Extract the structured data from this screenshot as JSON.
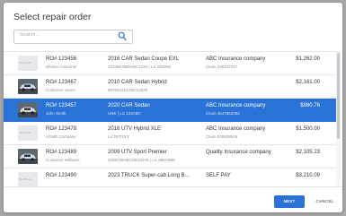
{
  "dialog": {
    "title": "Select repair order"
  },
  "search": {
    "placeholder": "Search..."
  },
  "rows": [
    {
      "ro": "RO# 123456",
      "customer": "Sholon Customer",
      "vehicle": "2016 CAR Sedan Coupe EXL",
      "vin": "1234567890ABC1234  |  Lic 000000",
      "insurer": "ABC Insurance company",
      "claim": "Claim 346247247",
      "amount": "$1,262.00",
      "thumb": "placeholder",
      "thumb_text": "No Photo"
    },
    {
      "ro": "RO# 123467",
      "customer": "Customer Jones",
      "vehicle": "2010 CAR Sedan Hybrid",
      "vin": "987654321ABC12345",
      "insurer": "",
      "claim": "",
      "amount": "$2,161.00",
      "thumb": "photo",
      "thumb_text": ""
    },
    {
      "ro": "RO# 123457",
      "customer": "John Smith",
      "vehicle": "2020 CAR Sedan",
      "vin": "UNK  |  Lic 123ABC",
      "insurer": "ABC Insurance company",
      "claim": "Claim 3547852002",
      "amount": "$980.76",
      "thumb": "photo",
      "thumb_text": "",
      "selected": true
    },
    {
      "ro": "RO# 123478",
      "customer": "ACME Company",
      "vehicle": "2016 UTV Hybrid XLE",
      "vin": "Lic R0T2XY",
      "insurer": "ABC Insurance company",
      "claim": "Claim 839528536",
      "amount": "$1,500.00",
      "thumb": "placeholder",
      "thumb_text": "No Photo"
    },
    {
      "ro": "RO# 123489",
      "customer": "Customer Williams",
      "vehicle": "2009 UTV Sport Premier",
      "vin": "3456789ABCDE12345  |  Lic 888AB88",
      "insurer": "Quality Insurance company",
      "claim": "",
      "amount": "$2,105.23",
      "thumb": "photo",
      "thumb_text": ""
    },
    {
      "ro": "RO# 123490",
      "customer": "",
      "vehicle": "2023 TRUCK Super-cab Long B...",
      "vin": "",
      "insurer": "SELF PAY",
      "claim": "",
      "amount": "$3,210.09",
      "thumb": "placeholder",
      "thumb_text": "No Photo"
    }
  ],
  "footer": {
    "next_label": "NEXT",
    "cancel_label": "CANCEL"
  },
  "colors": {
    "accent": "#2a72d6",
    "overlay": "#a9a9ab"
  },
  "icons": {
    "search": "search-icon"
  }
}
